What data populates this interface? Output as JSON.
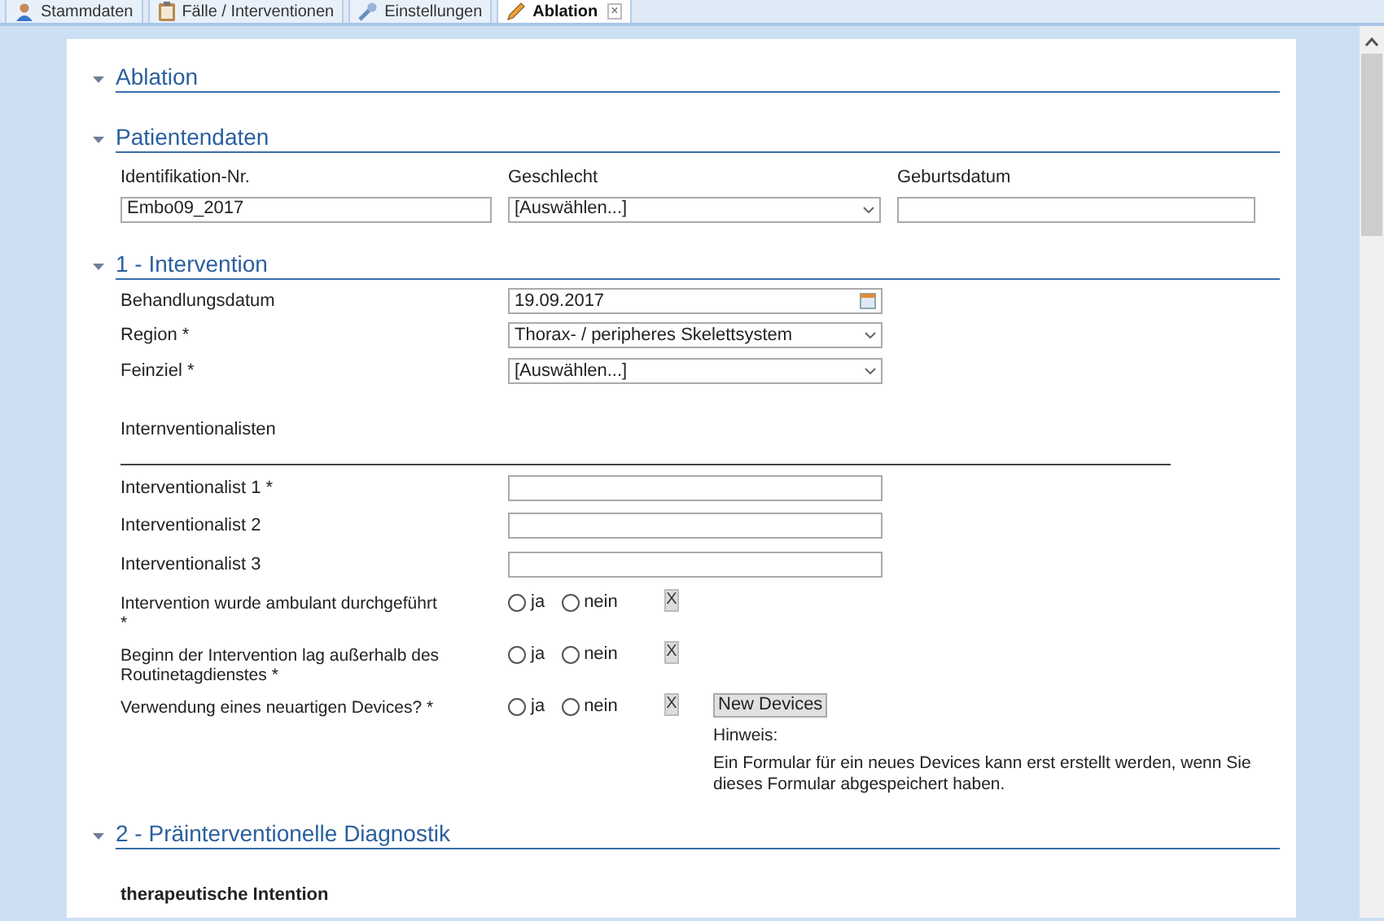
{
  "tabs": [
    {
      "label": "Stammdaten",
      "selected": false
    },
    {
      "label": "Fälle / Interventionen",
      "selected": false
    },
    {
      "label": "Einstellungen",
      "selected": false
    },
    {
      "label": "Ablation",
      "selected": true,
      "close_label": "×"
    }
  ],
  "form_title": "Ablation",
  "patient": {
    "title": "Patientendaten",
    "fields": [
      {
        "label": "Identifikation-Nr.",
        "kind": "text",
        "value": "Embo09_2017"
      },
      {
        "label": "Geschlecht",
        "kind": "select",
        "value": "[Auswählen...]"
      },
      {
        "label": "Geburtsdatum",
        "kind": "text"
      }
    ]
  },
  "intervention": {
    "title": "1 - Intervention",
    "rows": [
      {
        "label": "Behandlungsdatum",
        "kind": "date",
        "value": "19.09.2017"
      },
      {
        "label": "Region *",
        "kind": "select",
        "value": "Thorax- / peripheres Skelettsystem"
      },
      {
        "label": "Feinziel *",
        "kind": "select",
        "value": "[Auswählen...]"
      }
    ],
    "subheading": "Internventionalisten",
    "interventionalists": [
      {
        "label": "Interventionalist 1 *"
      },
      {
        "label": "Interventionalist 2"
      },
      {
        "label": "Interventionalist 3"
      }
    ],
    "questions": [
      {
        "label": "Intervention wurde ambulant durchgeführt *",
        "options": [
          {
            "label": "ja",
            "selected": false
          },
          {
            "label": "nein",
            "selected": false
          }
        ],
        "clear": "X"
      },
      {
        "label": "Beginn der Intervention lag außerhalb des Routinetagdienstes *",
        "options": [
          {
            "label": "ja",
            "selected": false
          },
          {
            "label": "nein",
            "selected": false
          }
        ],
        "clear": "X"
      },
      {
        "label": "Verwendung eines neuartigen Devices? *",
        "options": [
          {
            "label": "ja",
            "selected": false
          },
          {
            "label": "nein",
            "selected": false
          }
        ],
        "clear": "X",
        "button": "New Devices"
      }
    ],
    "hint_title": "Hinweis:",
    "hint": "Ein Formular für ein neues Devices kann erst erstellt werden, wenn Sie dieses Formular abgespeichert haben."
  },
  "diagnostics": {
    "title": "2 - Präinterventionelle Diagnostik",
    "subheading": "therapeutische Intention"
  }
}
